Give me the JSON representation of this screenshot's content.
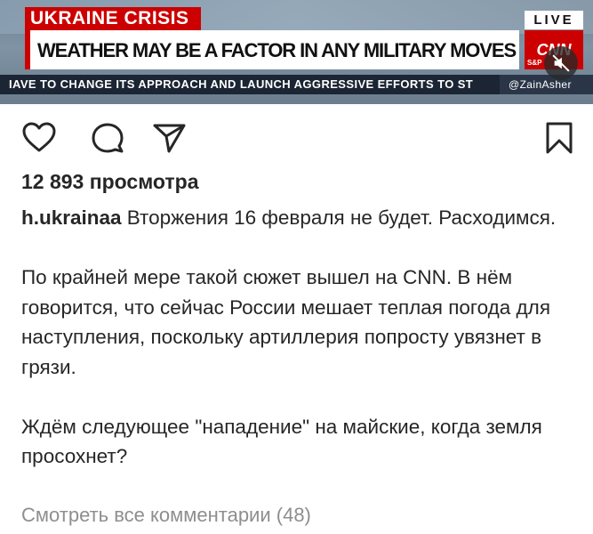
{
  "video": {
    "banner_label": "UKRAINE CRISIS",
    "headline": "WEATHER MAY BE A FACTOR IN ANY MILITARY MOVES BY RUSSIA",
    "live_label": "LIVE",
    "network_logo": "CNN",
    "index_label": "S&P",
    "ticker": "IAVE TO CHANGE ITS APPROACH AND LAUNCH AGGRESSIVE EFFORTS TO ST",
    "ticker_handle": "@ZainAsher",
    "mute_icon": "speaker-muted-icon"
  },
  "actions": {
    "like_icon": "heart-icon",
    "comment_icon": "comment-icon",
    "share_icon": "send-icon",
    "save_icon": "bookmark-icon"
  },
  "post": {
    "views": "12 893 просмотра",
    "username": "h.ukrainaa",
    "caption_first": " Вторжения 16 февраля не будет. Расходимся.",
    "paragraph_2": "По крайней мере такой сюжет вышел на CNN. В нём говорится, что сейчас России мешает теплая погода для наступления, поскольку артиллерия попросту увязнет в грязи.",
    "paragraph_3": "Ждём следующее \"нападение\" на майские, когда земля просохнет?",
    "view_comments": "Смотреть все комментарии (48)"
  },
  "colors": {
    "cnn_red": "#cc0000",
    "text": "#262626",
    "muted_text": "#8e8e8e"
  }
}
